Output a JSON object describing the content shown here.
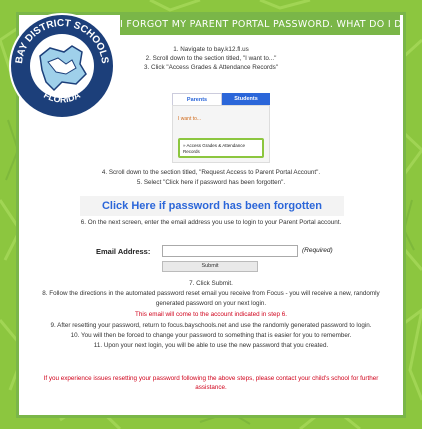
{
  "title": "I FORGOT MY PARENT PORTAL PASSWORD. WHAT DO I DO?",
  "logo": {
    "top_text": "BAY DISTRICT SCHOOLS",
    "bottom_text": "FLORIDA"
  },
  "steps": {
    "s1": "1. Navigate to bay.k12.fl.us",
    "s2": "2. Scroll down to the section titled, \"I want to...\"",
    "s3": "3. Click \"Access Grades & Attendance Records\"",
    "s4": "4. Scroll down to the section titled, \"Request Access to Parent Portal Account\".",
    "s5": "5. Select \"Click here if password has been forgotten\".",
    "s6": "6. On the next screen, enter the email address you use to login to your Parent Portal account.",
    "s7": "7. Click Submit.",
    "s8a": "8. Follow the directions in the automated password reset email you receive from Focus - you will receive a new, randomly",
    "s8b": "generated password on your next login.",
    "s8note": "This email will come to the account indicated in step 6.",
    "s9": "9. After resetting your password, return to focus.bayschools.net and use the randomly generated password to login.",
    "s10": "10. You will then be forced to change your password to something that is easier for you to remember.",
    "s11": "11. Upon your next login, you will be able to use the new password that you created."
  },
  "portal_screenshot": {
    "tab_parents": "Parents",
    "tab_students": "Students",
    "menu_heading": "I want to...",
    "menu_item": "» Access Grades & Attendance Records"
  },
  "forgot_link": "Click Here if password has been forgotten",
  "email_form": {
    "label": "Email Address:",
    "value": "",
    "required": "(Required)",
    "submit": "Submit"
  },
  "footer": {
    "line1": "If you experience issues resetting your password following the above steps, please contact your child's school for further",
    "line2": "assistance."
  },
  "colors": {
    "background": "#8cc63f",
    "accent_blue": "#2b66d9",
    "alert_red": "#d0021b",
    "logo_navy": "#1c3f7a"
  }
}
